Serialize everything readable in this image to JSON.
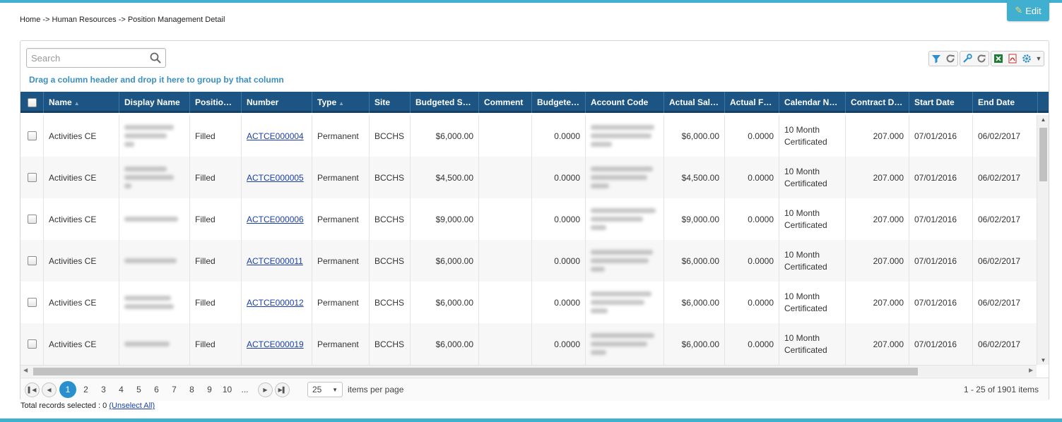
{
  "breadcrumb": "Home -> Human Resources -> Position Management Detail",
  "edit_label": "Edit",
  "search": {
    "placeholder": "Search"
  },
  "group_hint": "Drag a column header and drop it here to group by that column",
  "toolbar_icons": [
    "filter-icon",
    "refresh-icon",
    "wrench-icon",
    "refresh-icon",
    "excel-icon",
    "pdf-icon",
    "gear-icon"
  ],
  "columns": [
    {
      "label": "Name",
      "sortable": true
    },
    {
      "label": "Display Name"
    },
    {
      "label": "Position ..."
    },
    {
      "label": "Number"
    },
    {
      "label": "Type",
      "sortable": true
    },
    {
      "label": "Site"
    },
    {
      "label": "Budgeted Sal..."
    },
    {
      "label": "Comment"
    },
    {
      "label": "Budgeted..."
    },
    {
      "label": "Account Code"
    },
    {
      "label": "Actual Salary"
    },
    {
      "label": "Actual FTE"
    },
    {
      "label": "Calendar Na..."
    },
    {
      "label": "Contract Da..."
    },
    {
      "label": "Start Date"
    },
    {
      "label": "End Date"
    }
  ],
  "rows": [
    {
      "name": "Activities CE",
      "status": "Filled",
      "number": "ACTCE000004",
      "type": "Permanent",
      "site": "BCCHS",
      "budgeted_salary": "$6,000.00",
      "comment": "",
      "budgeted": "0.0000",
      "actual_salary": "$6,000.00",
      "actual_fte": "0.0000",
      "calendar": "10 Month Certificated",
      "contract": "207.000",
      "start": "07/01/2016",
      "end": "06/02/2017"
    },
    {
      "name": "Activities CE",
      "status": "Filled",
      "number": "ACTCE000005",
      "type": "Permanent",
      "site": "BCCHS",
      "budgeted_salary": "$4,500.00",
      "comment": "",
      "budgeted": "0.0000",
      "actual_salary": "$4,500.00",
      "actual_fte": "0.0000",
      "calendar": "10 Month Certificated",
      "contract": "207.000",
      "start": "07/01/2016",
      "end": "06/02/2017"
    },
    {
      "name": "Activities CE",
      "status": "Filled",
      "number": "ACTCE000006",
      "type": "Permanent",
      "site": "BCCHS",
      "budgeted_salary": "$9,000.00",
      "comment": "",
      "budgeted": "0.0000",
      "actual_salary": "$9,000.00",
      "actual_fte": "0.0000",
      "calendar": "10 Month Certificated",
      "contract": "207.000",
      "start": "07/01/2016",
      "end": "06/02/2017"
    },
    {
      "name": "Activities CE",
      "status": "Filled",
      "number": "ACTCE000011",
      "type": "Permanent",
      "site": "BCCHS",
      "budgeted_salary": "$6,000.00",
      "comment": "",
      "budgeted": "0.0000",
      "actual_salary": "$6,000.00",
      "actual_fte": "0.0000",
      "calendar": "10 Month Certificated",
      "contract": "207.000",
      "start": "07/01/2016",
      "end": "06/02/2017"
    },
    {
      "name": "Activities CE",
      "status": "Filled",
      "number": "ACTCE000012",
      "type": "Permanent",
      "site": "BCCHS",
      "budgeted_salary": "$6,000.00",
      "comment": "",
      "budgeted": "0.0000",
      "actual_salary": "$6,000.00",
      "actual_fte": "0.0000",
      "calendar": "10 Month Certificated",
      "contract": "207.000",
      "start": "07/01/2016",
      "end": "06/02/2017"
    },
    {
      "name": "Activities CE",
      "status": "Filled",
      "number": "ACTCE000019",
      "type": "Permanent",
      "site": "BCCHS",
      "budgeted_salary": "$6,000.00",
      "comment": "",
      "budgeted": "0.0000",
      "actual_salary": "$6,000.00",
      "actual_fte": "0.0000",
      "calendar": "10 Month Certificated",
      "contract": "207.000",
      "start": "07/01/2016",
      "end": "06/02/2017"
    }
  ],
  "pager": {
    "pages": [
      "1",
      "2",
      "3",
      "4",
      "5",
      "6",
      "7",
      "8",
      "9",
      "10",
      "..."
    ],
    "current": "1",
    "page_size": "25",
    "items_per_page_label": "items per page",
    "info": "1 - 25 of 1901 items"
  },
  "records": {
    "label": "Total records selected : 0",
    "unselect_label": "(Unselect All)"
  },
  "colors": {
    "accent": "#41afd0",
    "header_bg": "#1c5584",
    "link": "#1a3fa8",
    "active_page": "#2a8fcf"
  }
}
